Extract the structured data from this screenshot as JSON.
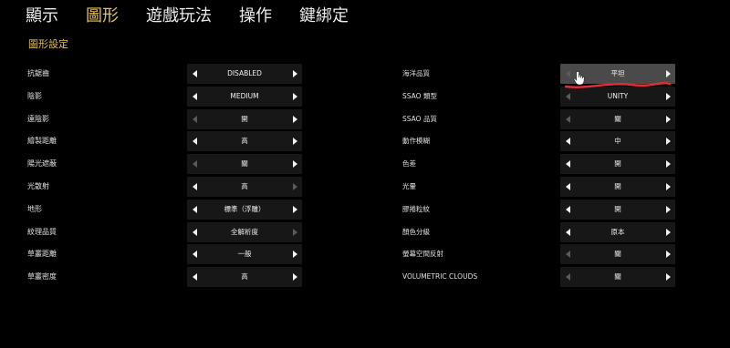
{
  "tabs": [
    {
      "label": "顯示",
      "active": false
    },
    {
      "label": "圖形",
      "active": true
    },
    {
      "label": "遊戲玩法",
      "active": false
    },
    {
      "label": "操作",
      "active": false
    },
    {
      "label": "鍵綁定",
      "active": false
    }
  ],
  "section_title": "圖形設定",
  "colors": {
    "accent": "#e3c15f",
    "background": "#000000",
    "selector_bg": "#171717",
    "selector_highlight_bg": "#4a4a4a",
    "scribble": "#e0303a"
  },
  "left_settings": [
    {
      "label": "抗鋸齒",
      "value": "DISABLED",
      "left_enabled": true,
      "right_enabled": true
    },
    {
      "label": "陰影",
      "value": "MEDIUM",
      "left_enabled": true,
      "right_enabled": true
    },
    {
      "label": "遠陰影",
      "value": "開",
      "left_enabled": false,
      "right_enabled": true
    },
    {
      "label": "繪製距離",
      "value": "高",
      "left_enabled": true,
      "right_enabled": true
    },
    {
      "label": "陽光遮蔽",
      "value": "關",
      "left_enabled": false,
      "right_enabled": true
    },
    {
      "label": "光散射",
      "value": "高",
      "left_enabled": true,
      "right_enabled": false
    },
    {
      "label": "地形",
      "value": "標準（浮雕）",
      "left_enabled": true,
      "right_enabled": true
    },
    {
      "label": "紋理品質",
      "value": "全解析度",
      "left_enabled": true,
      "right_enabled": false
    },
    {
      "label": "草叢距離",
      "value": "一般",
      "left_enabled": true,
      "right_enabled": true
    },
    {
      "label": "草叢密度",
      "value": "高",
      "left_enabled": true,
      "right_enabled": true
    }
  ],
  "right_settings": [
    {
      "label": "海洋品質",
      "value": "平坦",
      "left_enabled": false,
      "right_enabled": true,
      "highlighted": true
    },
    {
      "label": "SSAO 類型",
      "value": "UNITY",
      "left_enabled": false,
      "right_enabled": true
    },
    {
      "label": "SSAO 品質",
      "value": "關",
      "left_enabled": false,
      "right_enabled": true
    },
    {
      "label": "動作模糊",
      "value": "中",
      "left_enabled": true,
      "right_enabled": true
    },
    {
      "label": "色差",
      "value": "開",
      "left_enabled": true,
      "right_enabled": true
    },
    {
      "label": "光暈",
      "value": "開",
      "left_enabled": true,
      "right_enabled": true
    },
    {
      "label": "膠捲粒紋",
      "value": "開",
      "left_enabled": true,
      "right_enabled": true
    },
    {
      "label": "顏色分級",
      "value": "原本",
      "left_enabled": true,
      "right_enabled": true
    },
    {
      "label": "螢幕空間反射",
      "value": "關",
      "left_enabled": false,
      "right_enabled": true
    },
    {
      "label": "VOLUMETRIC CLOUDS",
      "value": "關",
      "left_enabled": false,
      "right_enabled": true
    }
  ]
}
